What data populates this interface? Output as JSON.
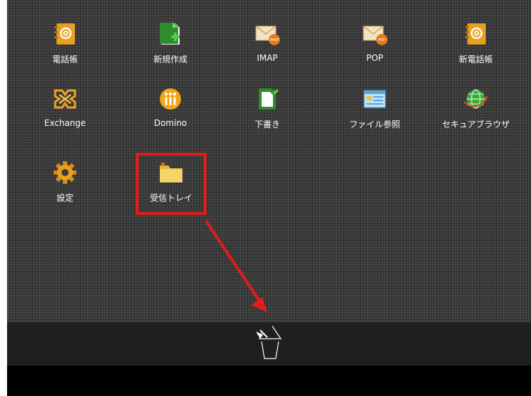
{
  "apps": [
    {
      "name": "電話帳",
      "icon": "address-book-icon"
    },
    {
      "name": "新規作成",
      "icon": "new-document-icon"
    },
    {
      "name": "IMAP",
      "icon": "imap-mail-icon",
      "badge": "IMAP"
    },
    {
      "name": "POP",
      "icon": "pop-mail-icon",
      "badge": "POP"
    },
    {
      "name": "新電話帳",
      "icon": "address-book-icon"
    },
    {
      "name": "Exchange",
      "icon": "exchange-icon"
    },
    {
      "name": "Domino",
      "icon": "domino-icon"
    },
    {
      "name": "下書き",
      "icon": "draft-icon"
    },
    {
      "name": "ファイル参照",
      "icon": "folder-window-icon"
    },
    {
      "name": "セキュアブラウザ",
      "icon": "globe-icon"
    },
    {
      "name": "設定",
      "icon": "gear-icon"
    },
    {
      "name": "受信トレイ",
      "icon": "inbox-folder-icon"
    }
  ],
  "dock": {
    "icon": "trash-icon"
  },
  "colors": {
    "highlight": "#e21b1b",
    "dock": "#1f1f1f",
    "background": "#3b3b3b"
  }
}
